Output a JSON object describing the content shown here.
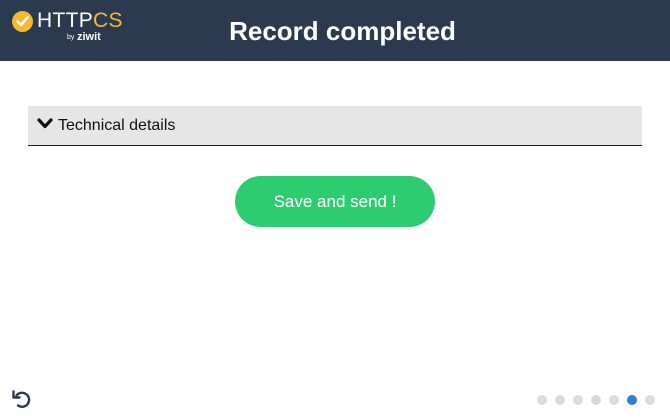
{
  "header": {
    "logo": {
      "word_main": "HTTP",
      "word_accent": "CS",
      "by": "by",
      "company": "ziwit",
      "accent_color": "#f5b82e"
    },
    "title": "Record completed",
    "background_color": "#2b3a4e"
  },
  "details": {
    "label": "Technical details",
    "icon": "chevron-down-icon",
    "expanded": false
  },
  "actions": {
    "save_label": "Save and send !",
    "save_color": "#2ecc71"
  },
  "footer": {
    "undo_icon": "undo-icon",
    "pagination": {
      "total": 7,
      "current": 6,
      "active_color": "#2f80d1",
      "inactive_color": "#d9d9d9"
    }
  }
}
